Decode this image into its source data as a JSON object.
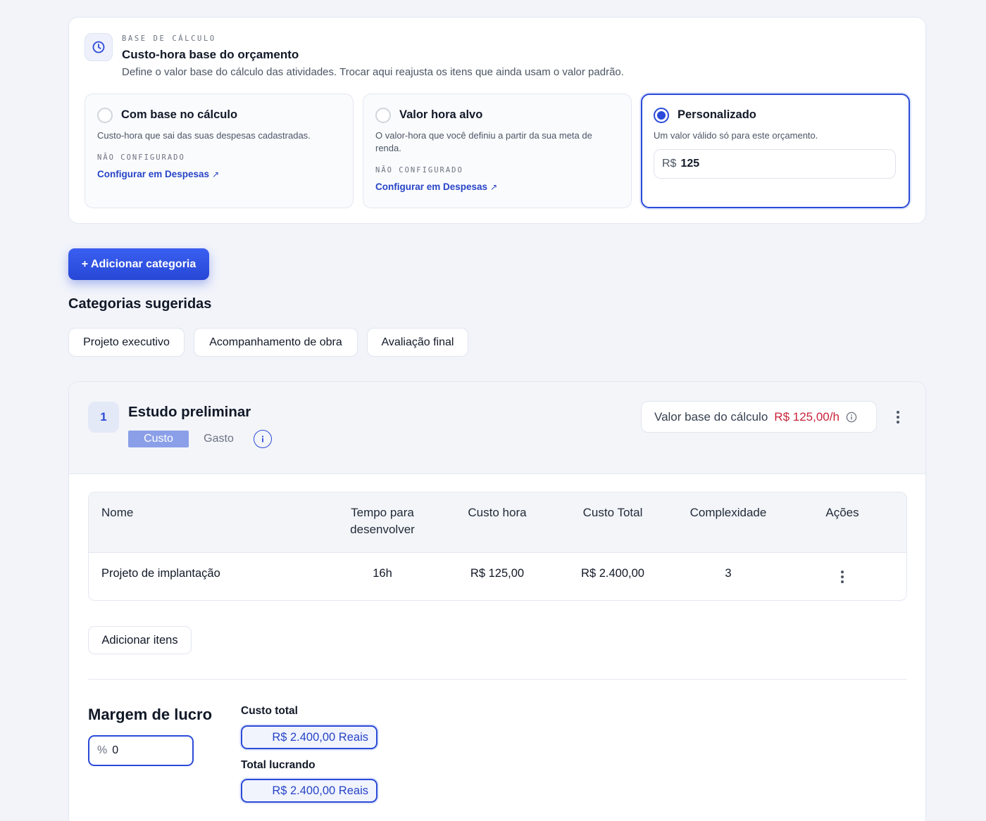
{
  "base": {
    "eyebrow": "BASE DE CÁLCULO",
    "title": "Custo-hora base do orçamento",
    "description": "Define o valor base do cálculo das atividades. Trocar aqui reajusta os itens que ainda usam o valor padrão.",
    "options": [
      {
        "title": "Com base no cálculo",
        "description": "Custo-hora que sai das suas despesas cadastradas.",
        "status": "NÃO CONFIGURADO",
        "link": "Configurar em Despesas",
        "selected": false
      },
      {
        "title": "Valor hora alvo",
        "description": "O valor-hora que você definiu a partir da sua meta de renda.",
        "status": "NÃO CONFIGURADO",
        "link": "Configurar em Despesas",
        "selected": false
      },
      {
        "title": "Personalizado",
        "description": "Um valor válido só para este orçamento.",
        "currency": "R$",
        "value": "125",
        "selected": true
      }
    ]
  },
  "actions": {
    "add_category": "+ Adicionar categoria"
  },
  "suggested": {
    "title": "Categorias sugeridas",
    "chips": [
      "Projeto executivo",
      "Acompanhamento de obra",
      "Avaliação final"
    ]
  },
  "category": {
    "number": "1",
    "name": "Estudo preliminar",
    "segments": [
      "Custo",
      "Gasto"
    ],
    "active_segment": "Custo",
    "base_label": "Valor base do cálculo",
    "base_value": "R$ 125,00/h",
    "table": {
      "columns": [
        "Nome",
        "Tempo para desenvolver",
        "Custo hora",
        "Custo Total",
        "Complexidade",
        "Ações"
      ],
      "rows": [
        {
          "name": "Projeto de implantação",
          "time": "16h",
          "hour_cost": "R$ 125,00",
          "total": "R$ 2.400,00",
          "complexity": "3"
        }
      ]
    },
    "add_items": "Adicionar itens",
    "margin": {
      "title": "Margem de lucro",
      "symbol": "%",
      "value": "0"
    },
    "summary": {
      "total_cost_label": "Custo total",
      "total_cost_value": "R$ 2.400,00 Reais",
      "total_profit_label": "Total lucrando",
      "total_profit_value": "R$ 2.400,00 Reais"
    }
  },
  "colors": {
    "accent": "#2b4bd8",
    "link": "#2744c7",
    "price_red": "#c8243b",
    "background": "#f2f4fa"
  },
  "icons": [
    "clock-icon",
    "external-link-icon",
    "info-icon",
    "kebab-menu-icon"
  ]
}
